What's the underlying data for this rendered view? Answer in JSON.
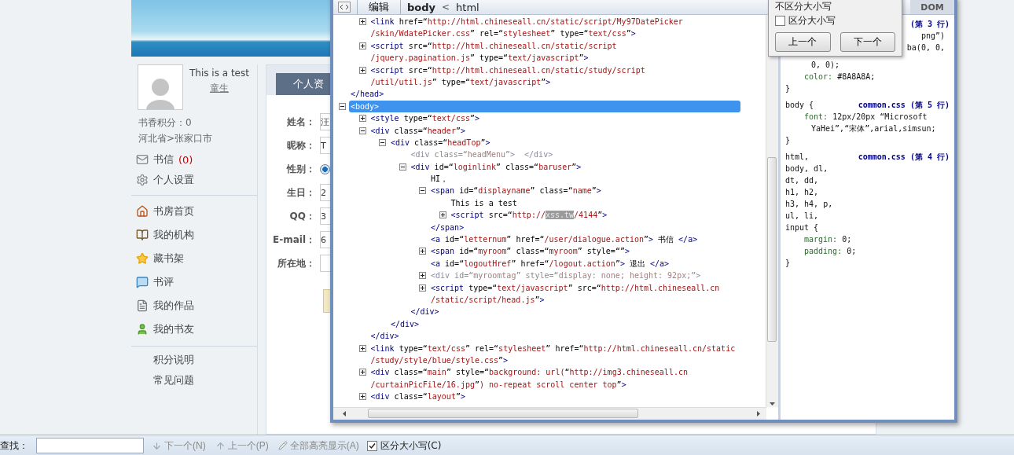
{
  "sidebar": {
    "name": "This is a test",
    "rank": "童生",
    "points": "书香积分：0",
    "location": "河北省>张家口市",
    "menu_top": [
      {
        "label": "书信",
        "count": "(0)"
      },
      {
        "label": "个人设置"
      }
    ],
    "menu_main": [
      {
        "label": "书房首页"
      },
      {
        "label": "我的机构"
      },
      {
        "label": "藏书架"
      },
      {
        "label": "书评"
      },
      {
        "label": "我的作品"
      },
      {
        "label": "我的书友"
      }
    ],
    "menu_bottom": [
      {
        "label": "积分说明"
      },
      {
        "label": "常见问题"
      }
    ]
  },
  "profile": {
    "tabs": [
      {
        "label": "个人资",
        "selected": true
      }
    ],
    "fields": [
      {
        "label": "姓名：",
        "kind": "text",
        "value": "汪"
      },
      {
        "label": "昵称：",
        "kind": "text",
        "value": "T"
      },
      {
        "label": "性别：",
        "kind": "radio",
        "checked": true
      },
      {
        "label": "生日：",
        "kind": "text",
        "value": "2"
      },
      {
        "label": "QQ：",
        "kind": "text",
        "value": "3"
      },
      {
        "label": "E-mail：",
        "kind": "text",
        "value": "6"
      },
      {
        "label": "所在地：",
        "kind": "select"
      }
    ]
  },
  "devtools": {
    "edit": "编辑",
    "breadcrumb": [
      {
        "label": "body",
        "selected": true
      },
      {
        "label": "html",
        "selected": false
      }
    ],
    "separator": "<",
    "side_tab": "DOM",
    "tree": [
      {
        "children": [
          {
            "text": [
              "<link href=“http://html.chineseall.cn/static/script/My97DatePicker",
              "/skin/WdatePicker.css” rel=“stylesheet” type=“text/css”>"
            ],
            "expanded": false,
            "selected": false,
            "dimmed": false
          },
          {
            "text": [
              "<script src=“http://html.chineseall.cn/static/script",
              "/jquery.pagination.js” type=“text/javascript”>"
            ],
            "expanded": false,
            "selected": false,
            "dimmed": false
          },
          {
            "text": [
              "<script src=“http://html.chineseall.cn/static/study/script",
              "/util/util.js” type=“text/javascript”>"
            ],
            "expanded": false,
            "selected": false,
            "dimmed": false
          }
        ]
      },
      {
        "text": [
          "</head>"
        ],
        "selected": false,
        "dimmed": false
      },
      {
        "text": [
          "<body>"
        ],
        "expanded": true,
        "selected": true,
        "dimmed": false,
        "children": [
          {
            "text": [
              "<style type=“text/css”>"
            ],
            "expanded": false,
            "selected": false,
            "dimmed": false
          },
          {
            "text": [
              "<div class=“header”>"
            ],
            "expanded": true,
            "selected": false,
            "dimmed": false,
            "children": [
              {
                "text": [
                  "<div class=“headTop”>"
                ],
                "expanded": true,
                "selected": false,
                "dimmed": false,
                "children": [
                  {
                    "text": [
                      "<div class=“headMenu”>  </div>"
                    ],
                    "selected": false,
                    "dimmed": true
                  },
                  {
                    "text": [
                      "<div id=“loginlink” class=“baruser”>"
                    ],
                    "expanded": true,
                    "selected": false,
                    "dimmed": false,
                    "children": [
                      {
                        "text": [
                          "HI，"
                        ],
                        "selected": false,
                        "dimmed": false
                      },
                      {
                        "text": [
                          "<span id=“displayname” class=“name”>"
                        ],
                        "expanded": true,
                        "selected": false,
                        "dimmed": false,
                        "children": [
                          {
                            "text": [
                              "This is a test"
                            ],
                            "selected": false,
                            "dimmed": false
                          },
                          {
                            "text": [
                              [
                                {
                                  "text": "<script src=“http://",
                                  "highlighted": false
                                },
                                {
                                  "text": "xss.tw",
                                  "highlighted": true
                                },
                                {
                                  "text": "/4144”>",
                                  "highlighted": false
                                }
                              ]
                            ],
                            "expanded": false,
                            "selected": false,
                            "dimmed": false
                          }
                        ]
                      },
                      {
                        "text": [
                          "</span>"
                        ],
                        "selected": false,
                        "dimmed": false
                      },
                      {
                        "text": [
                          "<a id=“letternum” href=“/user/dialogue.action”> 书信 </a>"
                        ],
                        "selected": false,
                        "dimmed": false
                      },
                      {
                        "text": [
                          "<span id=“myroom” class=“myroom” style=“”>"
                        ],
                        "expanded": false,
                        "selected": false,
                        "dimmed": false
                      },
                      {
                        "text": [
                          "<a id=“logoutHref” href=“/logout.action”> 退出 </a>"
                        ],
                        "selected": false,
                        "dimmed": false
                      },
                      {
                        "text": [
                          "<div id=“myroomtag” style=“display: none; height: 92px;”>"
                        ],
                        "expanded": false,
                        "selected": false,
                        "dimmed": true
                      },
                      {
                        "text": [
                          "<script type=“text/javascript” src=“http://html.chineseall.cn",
                          "/static/script/head.js”>"
                        ],
                        "expanded": false,
                        "selected": false,
                        "dimmed": false
                      }
                    ]
                  },
                  {
                    "text": [
                      "</div>"
                    ],
                    "selected": false,
                    "dimmed": false
                  }
                ]
              },
              {
                "text": [
                  "</div>"
                ],
                "selected": false,
                "dimmed": false
              }
            ]
          },
          {
            "text": [
              "</div>"
            ],
            "selected": false,
            "dimmed": false
          },
          {
            "text": [
              "<link type=“text/css” rel=“stylesheet” href=“http://html.chineseall.cn/static",
              "/study/style/blue/style.css”>"
            ],
            "expanded": false,
            "selected": false,
            "dimmed": false
          },
          {
            "text": [
              "<div class=“main” style=“background: url(“http://img3.chineseall.cn",
              "/curtainPicFile/16.jpg”) no-repeat scroll center top”>"
            ],
            "expanded": false,
            "selected": false,
            "dimmed": false
          },
          {
            "text": [
              "<div class=“layout”>"
            ],
            "expanded": false,
            "selected": false,
            "dimmed": false
          }
        ]
      }
    ],
    "styles": [
      {
        "source": "(第 3 行)",
        "fragments": [
          {
            "text": "png”)",
            "kind": "tail"
          },
          {
            "text": "ba(0, 0,",
            "kind": "tail"
          },
          {
            "text": "0, 0);",
            "kind": "wrap"
          }
        ],
        "declarations": [
          {
            "property": "color:",
            "value": [
              "#8A8A8A;"
            ]
          }
        ],
        "close": "}"
      },
      {
        "selectors": [
          "body {"
        ],
        "source": "common.css (第 5 行)",
        "declarations": [
          {
            "property": "font:",
            "value": [
              "12px/20px “Microsoft",
              "YaHei”,“宋体”,arial,simsun;"
            ]
          }
        ],
        "close": "}"
      },
      {
        "selectors": [
          "html,",
          "body, dl,",
          "dt, dd,",
          "h1, h2,",
          "h3, h4, p,",
          "ul, li,",
          "input {"
        ],
        "source": "common.css (第 4 行)",
        "declarations": [
          {
            "property": "margin:",
            "value": [
              "0;"
            ]
          },
          {
            "property": "padding:",
            "value": [
              "0;"
            ]
          }
        ],
        "close": "}"
      }
    ]
  },
  "find_popup": {
    "option": "不区分大小写",
    "checkbox": {
      "label": "区分大小写",
      "checked": false
    },
    "buttons": [
      "上一个",
      "下一个"
    ]
  },
  "find_bar": {
    "label": "查找：",
    "buttons": [
      {
        "label": "下一个(N)",
        "disabled": true
      },
      {
        "label": "上一个(P)",
        "disabled": true
      },
      {
        "label": "全部高亮显示(A)",
        "disabled": true
      }
    ],
    "checkbox": {
      "label": "区分大小写(C)",
      "checked": true
    }
  }
}
